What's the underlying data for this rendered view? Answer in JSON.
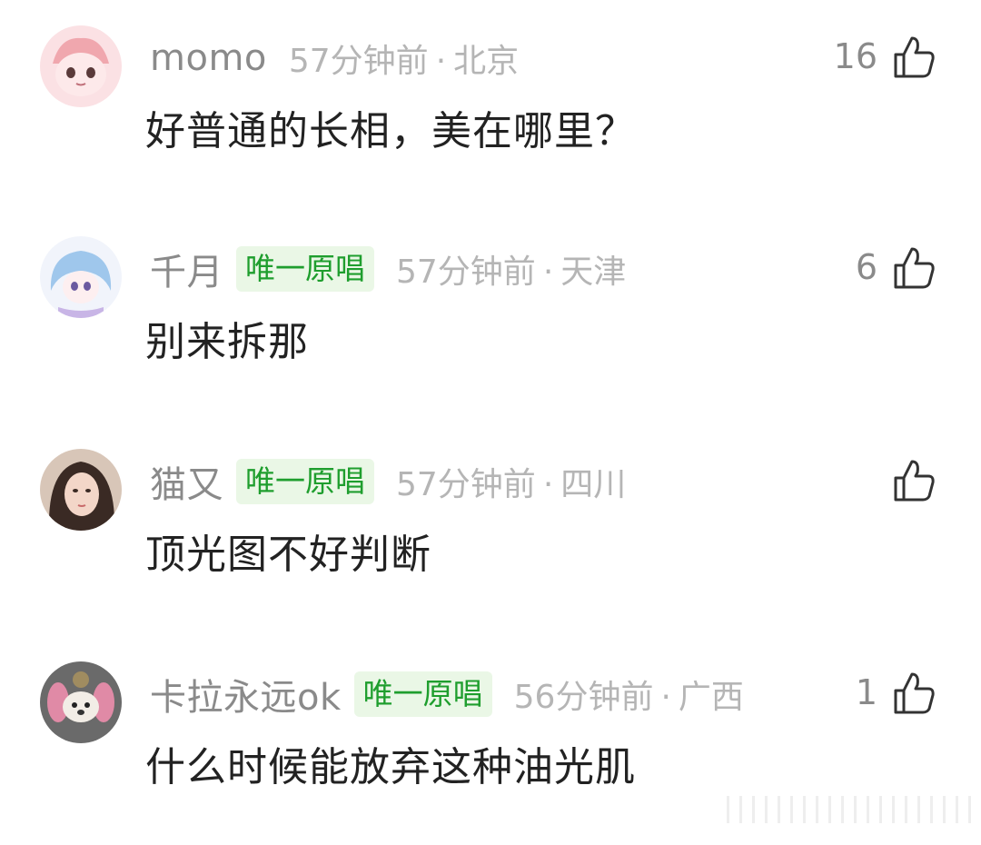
{
  "comments": [
    {
      "username": "momo",
      "badge": "",
      "time": "57分钟前",
      "location": "北京",
      "text": "好普通的长相，美在哪里？",
      "likes": "16",
      "avatar": "pink-cartoon-avatar"
    },
    {
      "username": "千月",
      "badge": "唯一原唱",
      "time": "57分钟前",
      "location": "天津",
      "text": "别来拆那",
      "likes": "6",
      "avatar": "anime-girl-avatar"
    },
    {
      "username": "猫又",
      "badge": "唯一原唱",
      "time": "57分钟前",
      "location": "四川",
      "text": "顶光图不好判断",
      "likes": "",
      "avatar": "photo-girl-avatar"
    },
    {
      "username": "卡拉永远ok",
      "badge": "唯一原唱",
      "time": "56分钟前",
      "location": "广西",
      "text": "什么时候能放弃这种油光肌",
      "likes": "1",
      "avatar": "dog-avatar"
    }
  ],
  "colors": {
    "username": "#8a8a8a",
    "meta": "#b5b5b5",
    "badge_bg": "#eaf7e6",
    "badge_text": "#1f9e2e",
    "content": "#222222"
  },
  "icons": {
    "like": "thumbs-up-icon"
  }
}
